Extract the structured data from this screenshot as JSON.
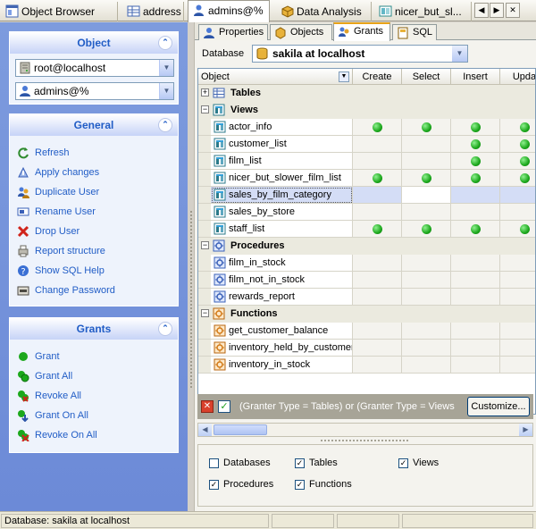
{
  "tabs": [
    {
      "label": "Object Browser",
      "icon": "object-browser-icon",
      "active": false
    },
    {
      "label": "address",
      "icon": "table-icon",
      "active": false
    },
    {
      "label": "admins@%",
      "icon": "user-icon",
      "active": true
    },
    {
      "label": "Data Analysis",
      "icon": "data-analysis-icon",
      "active": false
    },
    {
      "label": "nicer_but_sl...",
      "icon": "view-icon",
      "active": false
    }
  ],
  "tab_nav": {
    "prev": "◀",
    "next": "▶",
    "close": "✕"
  },
  "object_panel": {
    "title": "Object",
    "collapse": "⌃",
    "server": "root@localhost",
    "user": "admins@%"
  },
  "general_panel": {
    "title": "General",
    "collapse": "⌃",
    "items": [
      {
        "label": "Refresh",
        "icon": "refresh-icon"
      },
      {
        "label": "Apply changes",
        "icon": "apply-changes-icon"
      },
      {
        "label": "Duplicate User",
        "icon": "duplicate-user-icon"
      },
      {
        "label": "Rename User",
        "icon": "rename-user-icon"
      },
      {
        "label": "Drop User",
        "icon": "drop-user-icon"
      },
      {
        "label": "Report structure",
        "icon": "report-icon"
      },
      {
        "label": "Show SQL Help",
        "icon": "help-icon"
      },
      {
        "label": "Change Password",
        "icon": "password-icon"
      }
    ]
  },
  "grants_panel": {
    "title": "Grants",
    "collapse": "⌃",
    "items": [
      {
        "label": "Grant",
        "icon": "grant-icon"
      },
      {
        "label": "Grant All",
        "icon": "grant-all-icon"
      },
      {
        "label": "Revoke All",
        "icon": "revoke-all-icon"
      },
      {
        "label": "Grant On All",
        "icon": "grant-on-all-icon"
      },
      {
        "label": "Revoke On All",
        "icon": "revoke-on-all-icon"
      }
    ]
  },
  "subtabs": [
    {
      "label": "Properties",
      "icon": "properties-icon",
      "active": false
    },
    {
      "label": "Objects",
      "icon": "objects-icon",
      "active": false
    },
    {
      "label": "Grants",
      "icon": "grants-icon",
      "active": true
    },
    {
      "label": "SQL",
      "icon": "sql-icon",
      "active": false
    }
  ],
  "database": {
    "label": "Database",
    "value": "sakila at localhost"
  },
  "grid": {
    "columns": [
      "Object",
      "Create",
      "Select",
      "Insert",
      "Upda"
    ],
    "groups": [
      {
        "name": "Tables",
        "expander": "+",
        "rows": []
      },
      {
        "name": "Views",
        "expander": "−",
        "rows": [
          {
            "name": "actor_info",
            "perms": [
              true,
              true,
              true,
              true
            ],
            "selected": false
          },
          {
            "name": "customer_list",
            "perms": [
              false,
              false,
              true,
              true
            ],
            "selected": false
          },
          {
            "name": "film_list",
            "perms": [
              false,
              false,
              true,
              true
            ],
            "selected": false
          },
          {
            "name": "nicer_but_slower_film_list",
            "perms": [
              true,
              true,
              true,
              true
            ],
            "selected": false
          },
          {
            "name": "sales_by_film_category",
            "perms": [
              false,
              false,
              false,
              false
            ],
            "selected": true
          },
          {
            "name": "sales_by_store",
            "perms": [
              false,
              false,
              false,
              false
            ],
            "selected": false
          },
          {
            "name": "staff_list",
            "perms": [
              true,
              true,
              true,
              true
            ],
            "selected": false
          }
        ]
      },
      {
        "name": "Procedures",
        "expander": "−",
        "rows": [
          {
            "name": "film_in_stock",
            "perms": [
              false,
              false,
              false,
              false
            ],
            "selected": false
          },
          {
            "name": "film_not_in_stock",
            "perms": [
              false,
              false,
              false,
              false
            ],
            "selected": false
          },
          {
            "name": "rewards_report",
            "perms": [
              false,
              false,
              false,
              false
            ],
            "selected": false
          }
        ]
      },
      {
        "name": "Functions",
        "expander": "−",
        "rows": [
          {
            "name": "get_customer_balance",
            "perms": [
              false,
              false,
              false,
              false
            ],
            "selected": false
          },
          {
            "name": "inventory_held_by_customer",
            "perms": [
              false,
              false,
              false,
              false
            ],
            "selected": false
          },
          {
            "name": "inventory_in_stock",
            "perms": [
              false,
              false,
              false,
              false
            ],
            "selected": false
          }
        ]
      }
    ]
  },
  "filter": {
    "text": "(Granter Type = Tables) or (Granter Type = Views",
    "clear": "✕",
    "enabled": "✓",
    "customize": "Customize..."
  },
  "options": [
    {
      "label": "Databases",
      "checked": false
    },
    {
      "label": "Tables",
      "checked": true
    },
    {
      "label": "Views",
      "checked": true
    },
    {
      "label": "Procedures",
      "checked": true
    },
    {
      "label": "Functions",
      "checked": true
    }
  ],
  "status": {
    "text": "Database: sakila at localhost"
  },
  "colors": {
    "accent": "#215dc6",
    "grant_dot": "#1ca81c",
    "left_pane": "#7d9bde",
    "selected_row": "#d4ddf6"
  }
}
